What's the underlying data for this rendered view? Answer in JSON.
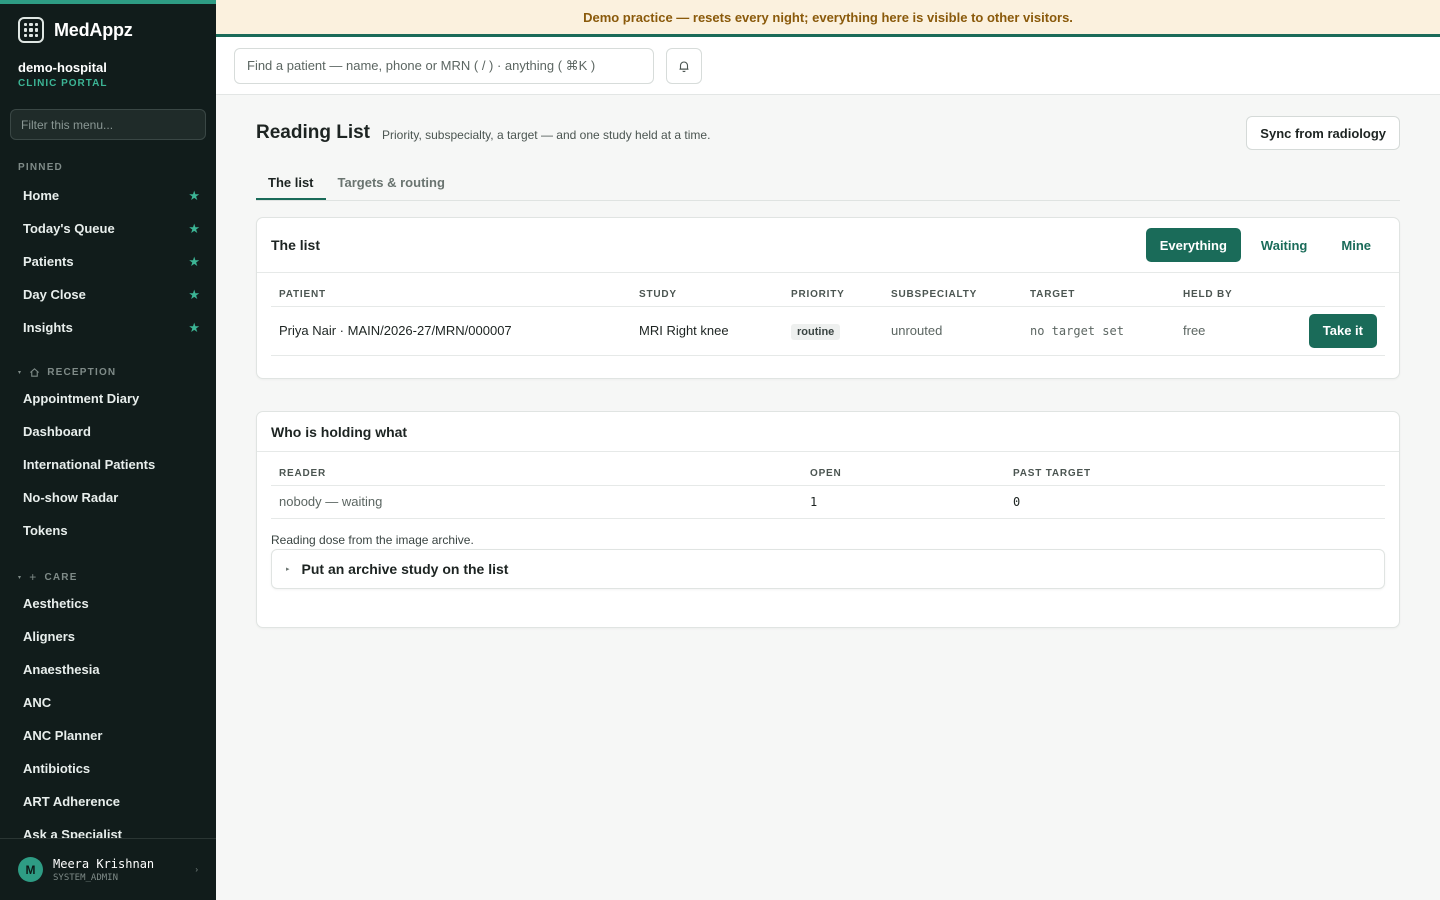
{
  "app": {
    "name": "MedAppz"
  },
  "org": {
    "name": "demo-hospital",
    "subtitle": "CLINIC PORTAL"
  },
  "sidebar": {
    "filter_placeholder": "Filter this menu...",
    "pinned_label": "PINNED",
    "pinned": [
      {
        "label": "Home",
        "icon": "star-icon"
      },
      {
        "label": "Today's Queue",
        "icon": "star-icon"
      },
      {
        "label": "Patients",
        "icon": "star-icon"
      },
      {
        "label": "Day Close",
        "icon": "star-icon"
      },
      {
        "label": "Insights",
        "icon": "star-icon"
      }
    ],
    "star_glyph": "★",
    "reception_label": "RECEPTION",
    "reception": [
      {
        "label": "Appointment Diary"
      },
      {
        "label": "Dashboard"
      },
      {
        "label": "International Patients"
      },
      {
        "label": "No-show Radar"
      },
      {
        "label": "Tokens"
      }
    ],
    "care_label": "CARE",
    "care": [
      {
        "label": "Aesthetics"
      },
      {
        "label": "Aligners"
      },
      {
        "label": "Anaesthesia"
      },
      {
        "label": "ANC"
      },
      {
        "label": "ANC Planner"
      },
      {
        "label": "Antibiotics"
      },
      {
        "label": "ART Adherence"
      },
      {
        "label": "Ask a Specialist"
      }
    ],
    "user": {
      "initial": "M",
      "name": "Meera Krishnan",
      "role": "SYSTEM_ADMIN"
    }
  },
  "banner": {
    "text": "Demo practice — resets every night; everything here is visible to other visitors."
  },
  "topbar": {
    "search_placeholder": "Find a patient — name, phone or MRN ( / ) · anything ( ⌘K )"
  },
  "page": {
    "title": "Reading List",
    "subtitle": "Priority, subspecialty, a target — and one study held at a time.",
    "sync_button": "Sync from radiology",
    "tabs": [
      {
        "label": "The list",
        "active": true
      },
      {
        "label": "Targets & routing",
        "active": false
      }
    ]
  },
  "list_card": {
    "title": "The list",
    "filters": [
      {
        "label": "Everything",
        "active": true
      },
      {
        "label": "Waiting",
        "active": false
      },
      {
        "label": "Mine",
        "active": false
      }
    ],
    "columns": [
      "PATIENT",
      "STUDY",
      "PRIORITY",
      "SUBSPECIALTY",
      "TARGET",
      "HELD BY"
    ],
    "rows": [
      {
        "patient": "Priya Nair · MAIN/2026-27/MRN/000007",
        "study": "MRI Right knee",
        "priority": "routine",
        "subspecialty": "unrouted",
        "target": "no target set",
        "held_by": "free",
        "action": "Take it"
      }
    ]
  },
  "holding_card": {
    "title": "Who is holding what",
    "columns": [
      "READER",
      "OPEN",
      "PAST TARGET"
    ],
    "rows": [
      {
        "reader": "nobody — waiting",
        "open": "1",
        "past_target": "0"
      }
    ],
    "note": "Reading dose from the image archive.",
    "disclosure": "Put an archive study on the list"
  },
  "colors": {
    "brand": "#1a6b59",
    "accent": "#3cb595",
    "banner_bg": "#fbf1de",
    "banner_text": "#8a5a0b",
    "sidebar_bg": "#111c1b"
  }
}
